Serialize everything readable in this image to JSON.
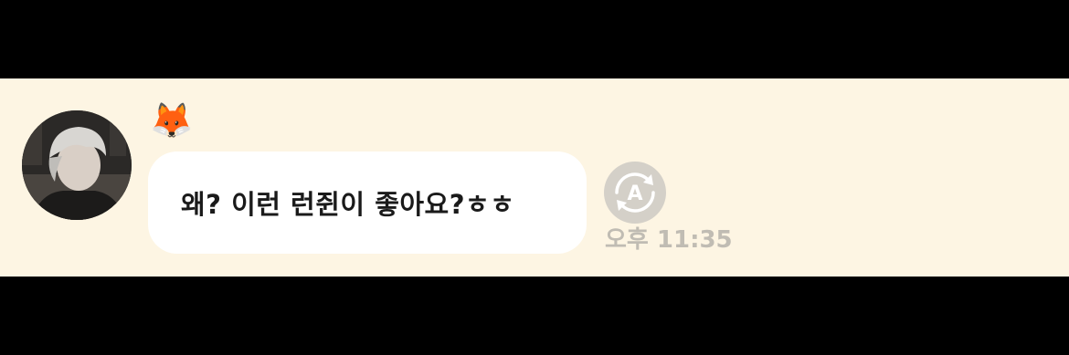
{
  "message": {
    "sender_emoji": "🦊",
    "text": "왜? 이런 런쥔이 좋아요?ㅎㅎ",
    "time": "오후 11:35"
  },
  "icons": {
    "avatar": "profile-photo",
    "translate": "auto-translate-icon",
    "translate_letter": "A"
  },
  "colors": {
    "chat_background": "#fdf5e3",
    "bubble": "#ffffff",
    "text": "#1a1a1a",
    "timestamp": "#c0bcb3",
    "translate_button": "#d4d0c8"
  }
}
